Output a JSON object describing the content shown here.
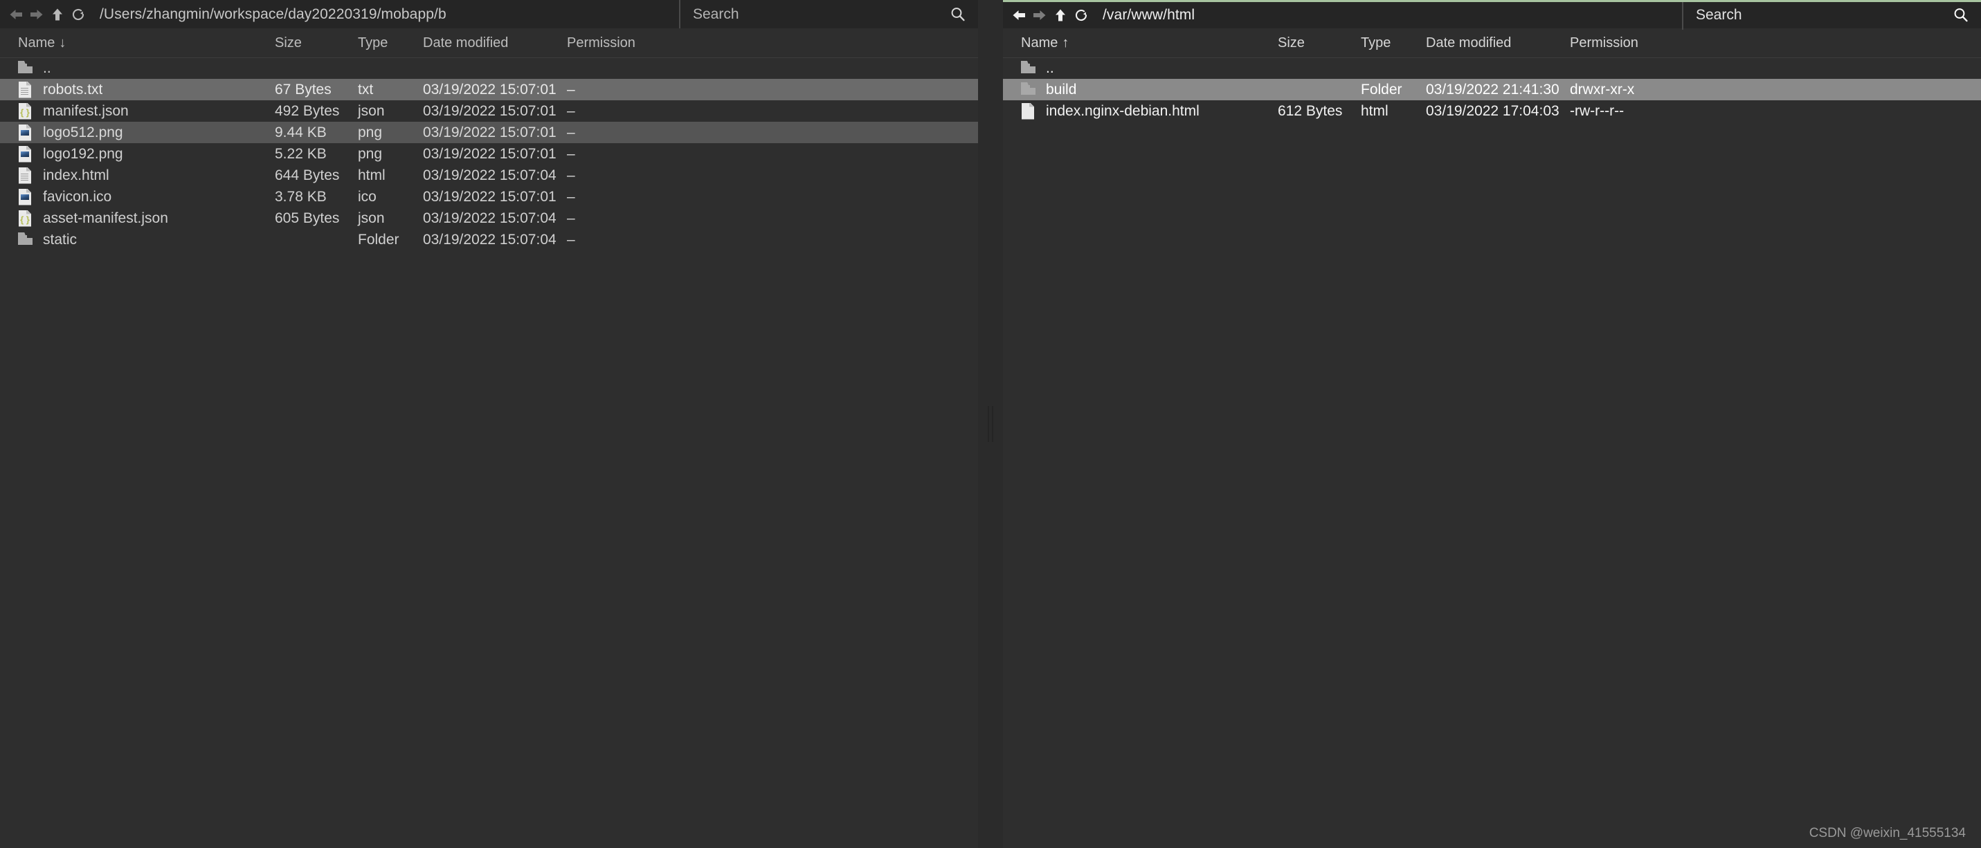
{
  "left_panel": {
    "toolbar": {
      "back_icon": "arrow-left-icon",
      "forward_icon": "arrow-right-icon",
      "up_icon": "arrow-up-icon",
      "refresh_icon": "refresh-icon",
      "path": "/Users/zhangmin/workspace/day20220319/mobapp/b",
      "search_placeholder": "Search",
      "search_value": "",
      "search_icon": "search-icon"
    },
    "columns": {
      "name": "Name",
      "sort_arrow": "↓",
      "size": "Size",
      "type": "Type",
      "date_modified": "Date modified",
      "permission": "Permission"
    },
    "rows": [
      {
        "name": "..",
        "icon": "folder-icon",
        "size": "",
        "type": "",
        "date": "",
        "permission": "",
        "state": "parent"
      },
      {
        "name": "robots.txt",
        "icon": "file-text-icon",
        "size": "67 Bytes",
        "type": "txt",
        "date": "03/19/2022 15:07:01",
        "permission": "–",
        "state": "selected"
      },
      {
        "name": "manifest.json",
        "icon": "file-json-icon",
        "size": "492 Bytes",
        "type": "json",
        "date": "03/19/2022 15:07:01",
        "permission": "–",
        "state": ""
      },
      {
        "name": "logo512.png",
        "icon": "file-image-icon",
        "size": "9.44 KB",
        "type": "png",
        "date": "03/19/2022 15:07:01",
        "permission": "–",
        "state": "hover"
      },
      {
        "name": "logo192.png",
        "icon": "file-image-icon",
        "size": "5.22 KB",
        "type": "png",
        "date": "03/19/2022 15:07:01",
        "permission": "–",
        "state": ""
      },
      {
        "name": "index.html",
        "icon": "file-text-icon",
        "size": "644 Bytes",
        "type": "html",
        "date": "03/19/2022 15:07:04",
        "permission": "–",
        "state": ""
      },
      {
        "name": "favicon.ico",
        "icon": "file-image-icon",
        "size": "3.78 KB",
        "type": "ico",
        "date": "03/19/2022 15:07:01",
        "permission": "–",
        "state": ""
      },
      {
        "name": "asset-manifest.json",
        "icon": "file-json-icon",
        "size": "605 Bytes",
        "type": "json",
        "date": "03/19/2022 15:07:04",
        "permission": "–",
        "state": ""
      },
      {
        "name": "static",
        "icon": "folder-icon",
        "size": "",
        "type": "Folder",
        "date": "03/19/2022 15:07:04",
        "permission": "–",
        "state": ""
      }
    ]
  },
  "right_panel": {
    "toolbar": {
      "back_icon": "arrow-left-icon",
      "forward_icon": "arrow-right-icon",
      "up_icon": "arrow-up-icon",
      "refresh_icon": "refresh-icon",
      "path": "/var/www/html",
      "search_placeholder": "Search",
      "search_value": "",
      "search_icon": "search-icon"
    },
    "columns": {
      "name": "Name",
      "sort_arrow": "↑",
      "size": "Size",
      "type": "Type",
      "date_modified": "Date modified",
      "permission": "Permission"
    },
    "rows": [
      {
        "name": "..",
        "icon": "folder-icon",
        "size": "",
        "type": "",
        "date": "",
        "permission": "",
        "state": "parent"
      },
      {
        "name": "build",
        "icon": "folder-icon",
        "size": "",
        "type": "Folder",
        "date": "03/19/2022 21:41:30",
        "permission": "drwxr-xr-x",
        "state": "selected"
      },
      {
        "name": "index.nginx-debian.html",
        "icon": "file-plain-icon",
        "size": "612 Bytes",
        "type": "html",
        "date": "03/19/2022 17:04:03",
        "permission": "-rw-r--r--",
        "state": ""
      }
    ]
  },
  "splitter": {
    "grip_icon": "splitter-grip-icon"
  },
  "watermark": {
    "text": "CSDN @weixin_41555134"
  },
  "colors": {
    "background": "#2e2e2e",
    "toolbar": "#252525",
    "selection_active": "#8a8a8a",
    "selection_inactive": "#6b6b6b",
    "hover": "#555555",
    "accent": "#a7c4a0",
    "text": "#d0d0d0"
  }
}
